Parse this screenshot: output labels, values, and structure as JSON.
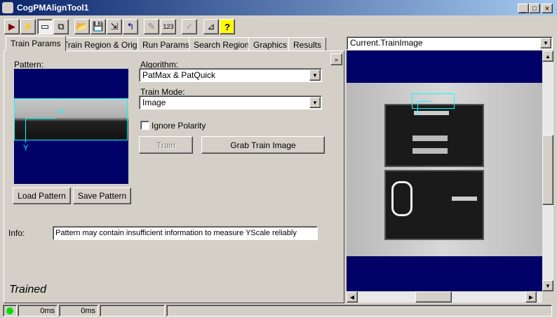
{
  "window": {
    "title": "CogPMAlignTool1"
  },
  "toolbar": [
    "run",
    "electric",
    "show-train",
    "show-search",
    "open",
    "save",
    "save-as",
    "reset",
    "wand",
    "numeric",
    "graph",
    "measure",
    "help"
  ],
  "tabs": [
    "Train Params",
    "Train Region & Origin",
    "Run Params",
    "Search Region",
    "Graphics",
    "Results"
  ],
  "active_tab": 0,
  "train": {
    "pattern_label": "Pattern:",
    "load_label": "Load Pattern",
    "save_label": "Save Pattern",
    "algorithm_label": "Algorithm:",
    "algorithm": "PatMax & PatQuick",
    "train_mode_label": "Train Mode:",
    "train_mode": "Image",
    "ignore_polarity": "Ignore Polarity",
    "ignore_polarity_checked": false,
    "train_label": "Train",
    "grab_label": "Grab Train Image",
    "info_label": "Info:",
    "info": "Pattern may contain insufficient information to measure YScale reliably",
    "status": "Trained",
    "axis_x": "X",
    "axis_y": "Y"
  },
  "display": {
    "image_select": "Current.TrainImage"
  },
  "statusbar": {
    "time1": "0ms",
    "time2": "0ms",
    "indicator_color": "#00e000"
  },
  "colors": {
    "title_start": "#0a246a",
    "title_end": "#a6caf0",
    "display_bg": "#000066",
    "graphics": "#00ffff"
  }
}
